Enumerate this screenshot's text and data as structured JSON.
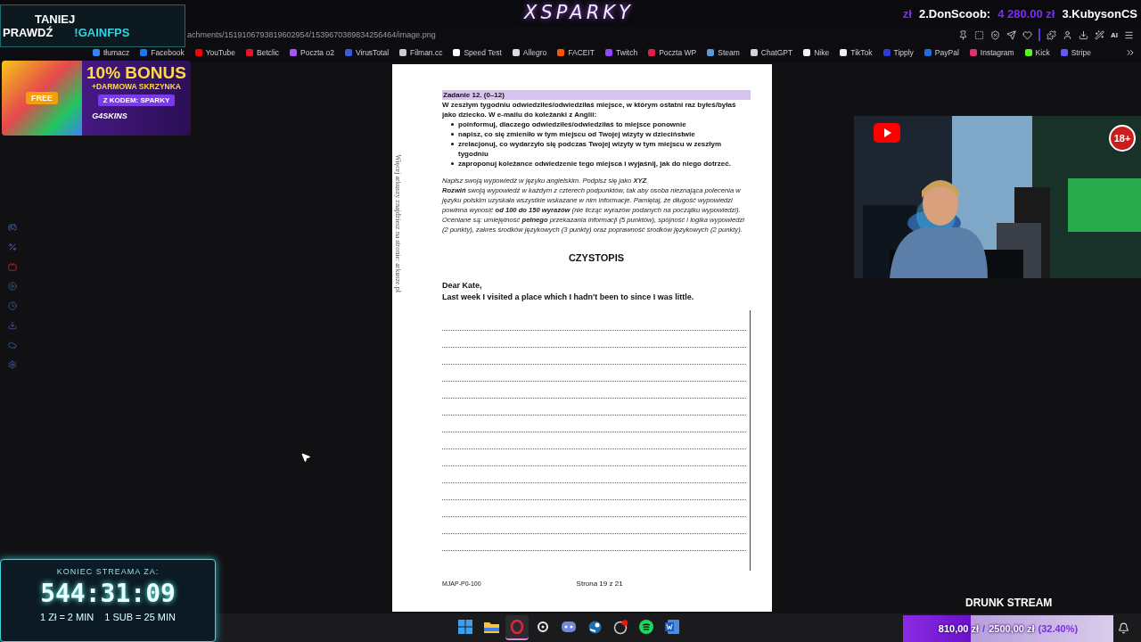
{
  "header": {
    "logo": "XSPARKY",
    "ticker": [
      {
        "text": "zł",
        "kind": "amount"
      },
      {
        "text": "2.DonScoob:",
        "kind": "name"
      },
      {
        "text": "4 280.00 zł",
        "kind": "amount"
      },
      {
        "text": "3.KubysonCS",
        "kind": "name"
      }
    ]
  },
  "promo": {
    "line1": "TANIEJ",
    "line2": "PRAWDŹ",
    "command": "!GAINFPS"
  },
  "browser": {
    "url": "achments/1519106793819602954/1539670389834256464/image.png",
    "ai_label": "AI",
    "bookmarks": [
      {
        "label": "tłumacz",
        "color": "#3b82f6"
      },
      {
        "label": "Facebook",
        "color": "#1877f2"
      },
      {
        "label": "YouTube",
        "color": "#ff0000"
      },
      {
        "label": "Betclic",
        "color": "#e3162b"
      },
      {
        "label": "Poczta o2",
        "color": "#a855f7"
      },
      {
        "label": "VirusTotal",
        "color": "#3b5bdb"
      },
      {
        "label": "Filman.cc",
        "color": "#cccccc"
      },
      {
        "label": "Speed Test",
        "color": "#ffffff"
      },
      {
        "label": "Allegro",
        "color": "#dddddd"
      },
      {
        "label": "FACEIT",
        "color": "#ff5500"
      },
      {
        "label": "Twitch",
        "color": "#9146ff"
      },
      {
        "label": "Poczta WP",
        "color": "#e11d48"
      },
      {
        "label": "Steam",
        "color": "#5b9bd5"
      },
      {
        "label": "ChatGPT",
        "color": "#d4d4d4"
      },
      {
        "label": "Nike",
        "color": "#f5f5f5"
      },
      {
        "label": "TikTok",
        "color": "#f0f0f0"
      },
      {
        "label": "Tipply",
        "color": "#2d3bdc"
      },
      {
        "label": "PayPal",
        "color": "#1e6fd9"
      },
      {
        "label": "Instagram",
        "color": "#e1306c"
      },
      {
        "label": "Kick",
        "color": "#53fc18"
      },
      {
        "label": "Stripe",
        "color": "#635bff"
      }
    ]
  },
  "bonus_banner": {
    "tag": "FREE",
    "headline": "10% BONUS",
    "subline": "+DARMOWA SKRZYNKA",
    "code": "Z KODEM: SPARKY",
    "brand": "G4SKINS"
  },
  "document": {
    "task_title": "Zadanie 12. (0–12)",
    "intro": "W zeszłym tygodniu odwiedziłeś/odwiedziłaś miejsce, w którym ostatni raz byłeś/byłaś jako dziecko. W e-mailu do koleżanki z Anglii:",
    "bullets": [
      "poinformuj, dlaczego odwiedziłeś/odwiedziłaś to miejsce ponownie",
      "napisz, co się zmieniło w tym miejscu od Twojej wizyty w dzieciństwie",
      "zrelacjonuj, co wydarzyło się podczas Twojej wizyty w tym miejscu w zeszłym tygodniu",
      "zaproponuj koleżance odwiedzenie tego miejsca i wyjaśnij, jak do niego dotrzeć."
    ],
    "instructions": [
      "Napisz swoją wypowiedź w języku angielskim. Podpisz się jako **XYZ**.",
      "**Rozwiń** swoją wypowiedź w każdym z czterech podpunktów, tak aby osoba nieznająca polecenia w języku polskim uzyskała wszystkie wskazane w nim informacje. Pamiętaj, że długość wypowiedzi powinna wynosić **od 100 do 150 wyrazów** (nie licząc wyrazów podanych na początku wypowiedzi). Oceniane są: umiejętność **pełnego** przekazania informacji (5 punktów), spójność i logika wypowiedzi (2 punkty), zakres środków językowych (3 punkty) oraz poprawność środków językowych (2 punkty)."
    ],
    "section_title": "CZYSTOPIS",
    "greeting": "Dear Kate,",
    "opening": "Last week I visited a place which I hadn't been to since I was little.",
    "side_note": "Więcej arkuszy znajdziesz na stronie: arkusze.pl",
    "code": "MJAP-P0-100",
    "page": "Strona 19 z 21"
  },
  "webcam": {
    "badge": "18+"
  },
  "timer": {
    "title": "KONIEC STREAMA ZA:",
    "time": "544:31:09",
    "rates": [
      "1 Zł = 2 MIN",
      "1 SUB = 25 MIN"
    ]
  },
  "goal": {
    "title": "DRUNK STREAM",
    "current": "810,00 zł",
    "separator": "/",
    "target": "2500,00 zł",
    "percent": "(32.40%)",
    "level": 0.324
  },
  "taskbar": [
    {
      "kind": "windows",
      "selected": false
    },
    {
      "kind": "folder",
      "selected": false
    },
    {
      "kind": "opera",
      "selected": true
    },
    {
      "kind": "steelseries",
      "selected": false
    },
    {
      "kind": "discord",
      "selected": false
    },
    {
      "kind": "steam",
      "selected": false
    },
    {
      "kind": "obs",
      "selected": false
    },
    {
      "kind": "spotify",
      "selected": false
    },
    {
      "kind": "word",
      "selected": false
    }
  ]
}
